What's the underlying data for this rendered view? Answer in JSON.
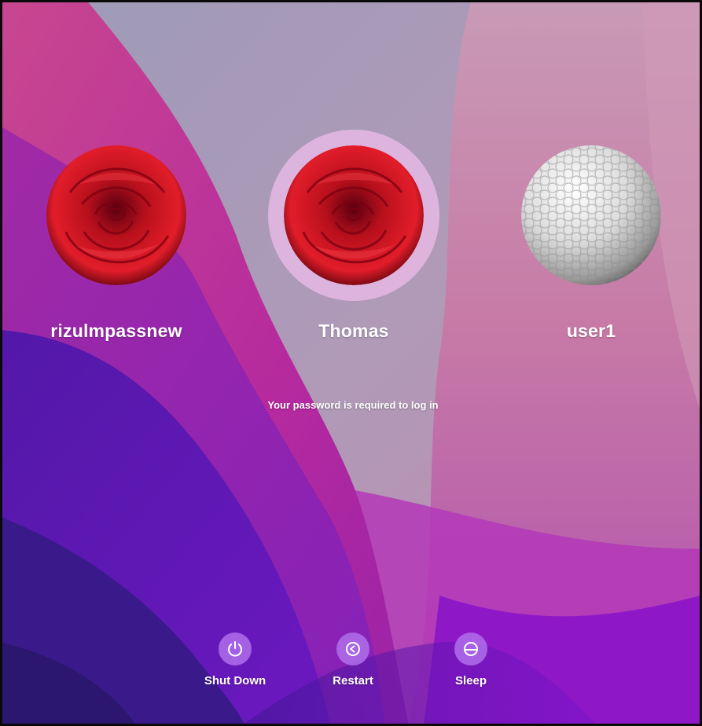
{
  "users": [
    {
      "name": "rizulmpassnew",
      "avatar": "rose-avatar",
      "selected": false
    },
    {
      "name": "Thomas",
      "avatar": "rose-avatar",
      "selected": true
    },
    {
      "name": "user1",
      "avatar": "golf-ball-avatar",
      "selected": false
    }
  ],
  "login": {
    "message": "Your password is required to log in"
  },
  "actions": [
    {
      "label": "Shut Down",
      "icon": "power-icon"
    },
    {
      "label": "Restart",
      "icon": "restart-icon"
    },
    {
      "label": "Sleep",
      "icon": "sleep-icon"
    }
  ],
  "colors": {
    "accent": "#b06eeb",
    "selected_ring": "#f0bee8",
    "text": "#ffffff"
  }
}
